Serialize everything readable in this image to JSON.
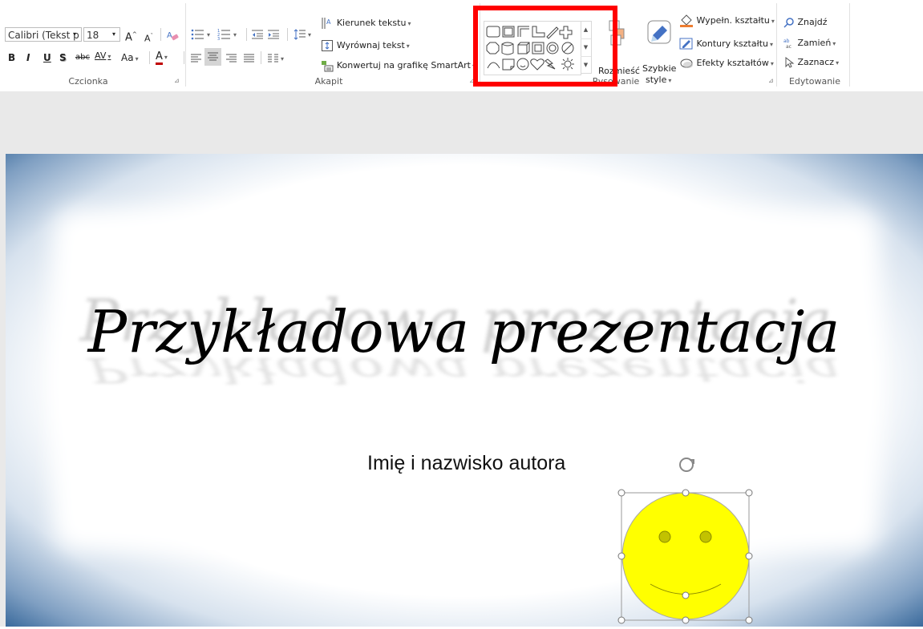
{
  "font_group": {
    "font_name": "Calibri (Tekst p",
    "font_size": "18",
    "bold": "B",
    "italic": "I",
    "underline": "U",
    "shadow": "S",
    "strike": "abc",
    "spacing": "AV",
    "change_case": "Aa",
    "font_color": "A",
    "grow": "A",
    "shrink": "A",
    "label": "Czcionka"
  },
  "paragraph_group": {
    "text_direction": "Kierunek tekstu",
    "align_text": "Wyrównaj tekst",
    "smartart": "Konwertuj na grafikę SmartArt",
    "label": "Akapit"
  },
  "drawing_group": {
    "arrange": "Rozmieść",
    "quick_styles_1": "Szybkie",
    "quick_styles_2": "style",
    "shape_fill": "Wypełn. kształtu",
    "shape_outline": "Kontury kształtu",
    "shape_effects": "Efekty kształtów",
    "label": "Rysowanie"
  },
  "editing_group": {
    "find": "Znajdź",
    "replace": "Zamień",
    "select": "Zaznacz",
    "label": "Edytowanie"
  },
  "slide": {
    "title": "Przykładowa prezentacja",
    "subtitle": "Imię i nazwisko autora"
  },
  "colors": {
    "highlight": "#ff0000",
    "smiley_fill": "#ffff00",
    "font_color_bar": "#c00000",
    "slide_border": "#2f5f93"
  }
}
